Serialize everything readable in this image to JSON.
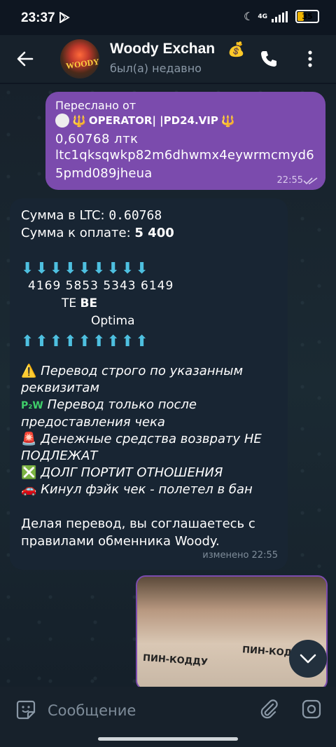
{
  "status_bar": {
    "time": "23:37",
    "network": "4G",
    "battery": "35"
  },
  "header": {
    "title": "Woody Exchan",
    "status": "был(а) недавно",
    "avatar_text": "WOODY"
  },
  "forwarded_message": {
    "label": "Переслано от",
    "from": "OPERATOR| |PD24.VIP",
    "amount": "0,60768  лтк",
    "address": "ltc1qksqwkp82m6dhwmx4eywrmcmyd65pmd089jheua",
    "time": "22:55"
  },
  "info_message": {
    "ltc_label": "Сумма в LTC: ",
    "ltc_value": "0.60768",
    "pay_label": "Сумма к оплате: ",
    "pay_value": "5 400",
    "arrows_down": "⬇⬇⬇⬇⬇⬇⬇⬇⬇",
    "card_number": "4169 5853 5343 6149",
    "bank_line1_a": "ТЕ ",
    "bank_line1_b": "ВЕ",
    "bank_line2": "Optima",
    "arrows_up": "⬆⬆⬆⬆⬆⬆⬆⬆⬆",
    "rules": [
      {
        "emoji": "⚠️",
        "text": "Перевод строго по указанным реквизитам"
      },
      {
        "emoji": "P₂W",
        "text": "Перевод только после предоставления чека"
      },
      {
        "emoji": "🚨",
        "text": "Денежные средства возврату НЕ ПОДЛЕЖАТ"
      },
      {
        "emoji": "❎",
        "text": "ДОЛГ ПОРТИТ ОТНОШЕНИЯ"
      },
      {
        "emoji": "🚗",
        "text": "Кинул фэйк чек - полетел в бан"
      }
    ],
    "footer": "Делая перевод, вы соглашаетесь с правилами обменника Woody.",
    "edited_time": "изменено 22:55"
  },
  "photo": {
    "text_left": "ПИН-КОДДУ",
    "text_right": "ПИН-КОДД"
  },
  "composer": {
    "placeholder": "Сообщение"
  },
  "colors": {
    "outgoing_bubble": "#7b4bad",
    "incoming_bubble": "#182533",
    "header": "#17212b"
  }
}
